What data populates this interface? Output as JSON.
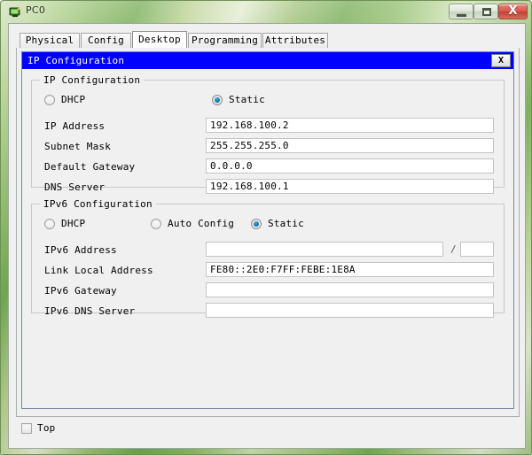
{
  "window": {
    "title": "PC0",
    "icon": "pc-device-icon",
    "controls": {
      "minimize": "—",
      "maximize": "□",
      "close": "X"
    }
  },
  "tabs": [
    {
      "label": "Physical",
      "active": false
    },
    {
      "label": "Config",
      "active": false
    },
    {
      "label": "Desktop",
      "active": true
    },
    {
      "label": "Programming",
      "active": false
    },
    {
      "label": "Attributes",
      "active": false
    }
  ],
  "dialog": {
    "title": "IP Configuration",
    "close_label": "X"
  },
  "ipv4": {
    "group_label": "IP Configuration",
    "modes": [
      {
        "label": "DHCP",
        "selected": false
      },
      {
        "label": "Static",
        "selected": true
      }
    ],
    "fields": [
      {
        "label": "IP Address",
        "value": "192.168.100.2"
      },
      {
        "label": "Subnet Mask",
        "value": "255.255.255.0"
      },
      {
        "label": "Default Gateway",
        "value": "0.0.0.0"
      },
      {
        "label": "DNS Server",
        "value": "192.168.100.1"
      }
    ]
  },
  "ipv6": {
    "group_label": "IPv6 Configuration",
    "modes": [
      {
        "label": "DHCP",
        "selected": false
      },
      {
        "label": "Auto Config",
        "selected": false
      },
      {
        "label": "Static",
        "selected": true
      }
    ],
    "address": {
      "label": "IPv6 Address",
      "value": "",
      "separator": "/",
      "prefix_value": ""
    },
    "fields": [
      {
        "label": "Link Local Address",
        "value": "FE80::2E0:F7FF:FEBE:1E8A"
      },
      {
        "label": "IPv6 Gateway",
        "value": ""
      },
      {
        "label": "IPv6 DNS Server",
        "value": ""
      }
    ]
  },
  "footer": {
    "top_label": "Top",
    "top_checked": false
  },
  "colors": {
    "dialog_titlebar": "#0000ff",
    "dialog_title_text": "#ffffff",
    "radio_selected": "#1574b0",
    "close_button": "#c23f33",
    "frame_green": "#6ea84d"
  }
}
